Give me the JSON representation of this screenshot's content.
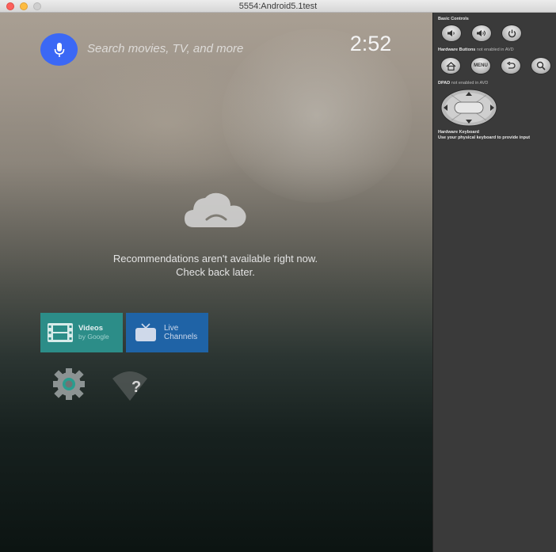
{
  "window": {
    "title": "5554:Android5.1test"
  },
  "screen": {
    "search_hint": "Search movies, TV, and more",
    "clock": "2:52",
    "recommendations_line1": "Recommendations aren't available right now.",
    "recommendations_line2": "Check back later.",
    "tiles": [
      {
        "title": "Videos",
        "subtitle": "by Google",
        "color": "#2c8d88",
        "icon": "film-icon"
      },
      {
        "title": "Live",
        "subtitle": "Channels",
        "color": "#1f63a6",
        "icon": "tv-icon"
      }
    ],
    "accent_color": "#3b68f5"
  },
  "controls": {
    "basic_controls_label": "Basic Controls",
    "hardware_buttons_label": "Hardware Buttons",
    "hardware_buttons_note": "not enabled in AVD",
    "dpad_label": "DPAD",
    "dpad_note": "not enabled in AVD",
    "menu_label": "MENU",
    "hardware_keyboard_label": "Hardware Keyboard",
    "hardware_keyboard_note": "Use your physical keyboard to provide input"
  }
}
